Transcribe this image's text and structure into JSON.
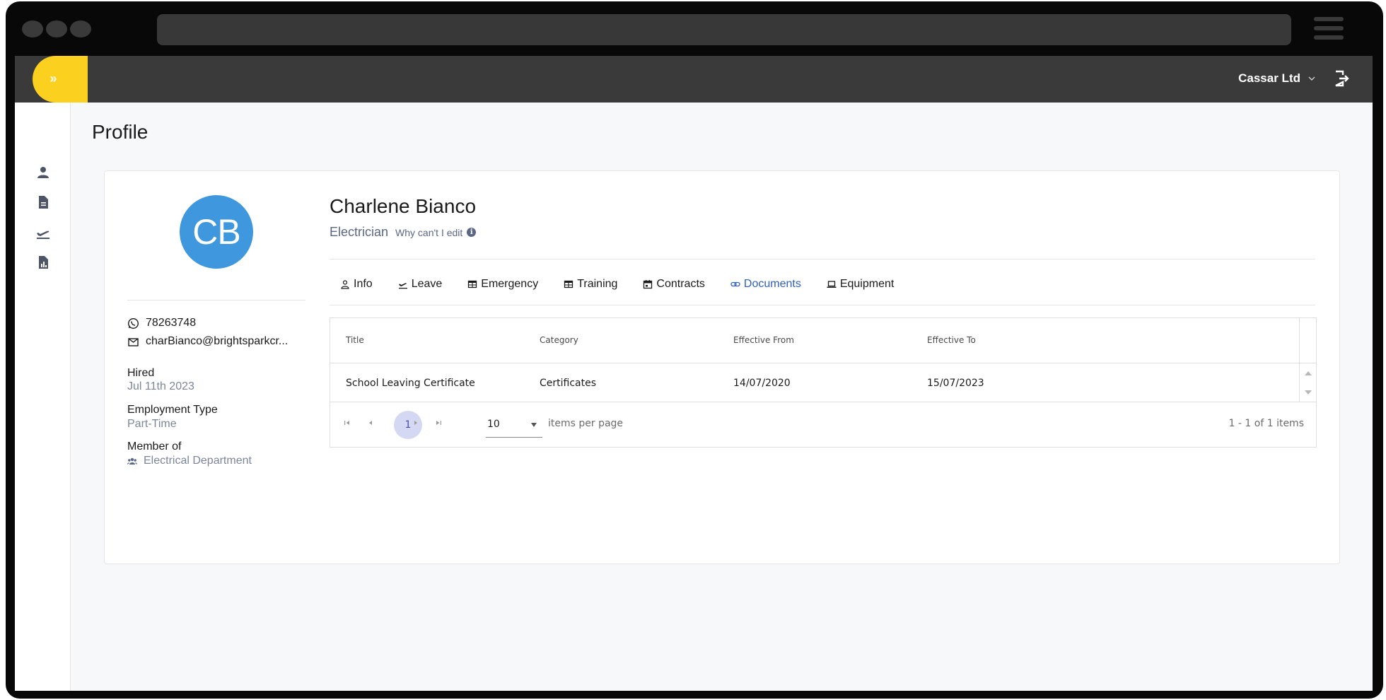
{
  "header": {
    "company_name": "Cassar Ltd",
    "toggle_icon": "double-chevron-right-icon",
    "logout_icon": "logout-icon",
    "accent_color": "#fcd01f"
  },
  "sidebar": {
    "items": [
      {
        "icon": "person-icon"
      },
      {
        "icon": "document-icon"
      },
      {
        "icon": "plane-departure-icon"
      },
      {
        "icon": "report-icon"
      }
    ]
  },
  "page": {
    "title": "Profile"
  },
  "profile": {
    "initials": "CB",
    "avatar_color": "#3f97dd",
    "name": "Charlene Bianco",
    "role": "Electrician",
    "why_cant_edit": "Why can't I edit",
    "phone": "78263748",
    "email": "charBianco@brightsparkcr...",
    "hired_label": "Hired",
    "hired_value": "Jul 11th 2023",
    "employment_type_label": "Employment Type",
    "employment_type_value": "Part-Time",
    "member_of_label": "Member of",
    "member_of_value": "Electrical Department"
  },
  "tabs": [
    {
      "label": "Info",
      "icon": "person-icon",
      "active": false
    },
    {
      "label": "Leave",
      "icon": "plane-departure-icon",
      "active": false
    },
    {
      "label": "Emergency",
      "icon": "table-icon",
      "active": false
    },
    {
      "label": "Training",
      "icon": "table-icon",
      "active": false
    },
    {
      "label": "Contracts",
      "icon": "calendar-icon",
      "active": false
    },
    {
      "label": "Documents",
      "icon": "link-icon",
      "active": true
    },
    {
      "label": "Equipment",
      "icon": "laptop-icon",
      "active": false
    }
  ],
  "grid": {
    "columns": [
      "Title",
      "Category",
      "Effective From",
      "Effective To"
    ],
    "rows": [
      [
        "School Leaving Certificate",
        "Certificates",
        "14/07/2020",
        "15/07/2023"
      ]
    ],
    "pager": {
      "current_page": "1",
      "page_size": "10",
      "page_size_label": "items per page",
      "info": "1 - 1 of 1 items"
    }
  }
}
